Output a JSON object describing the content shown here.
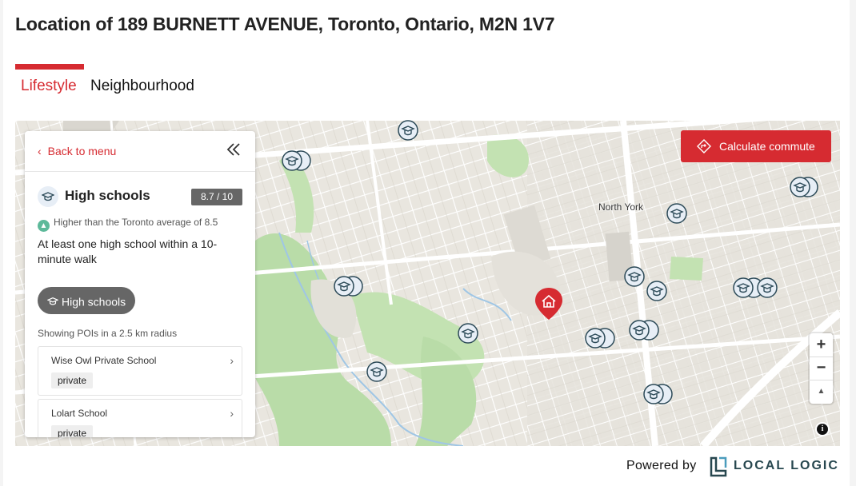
{
  "page": {
    "title": "Location of 189 BURNETT AVENUE, Toronto, Ontario, M2N 1V7"
  },
  "tabs": [
    {
      "label": "Lifestyle",
      "active": true
    },
    {
      "label": "Neighbourhood",
      "active": false
    }
  ],
  "panel": {
    "back_label": "Back to menu",
    "category_title": "High schools",
    "score": "8.7 / 10",
    "comparison": "Higher than the Toronto average of 8.5",
    "description": "At least one high school within a 10-minute walk",
    "filter_chip": "High schools",
    "radius_text": "Showing POIs in a 2.5 km radius",
    "pois": [
      {
        "name": "Wise Owl Private School",
        "tag": "private"
      },
      {
        "name": "Lolart School",
        "tag": "private"
      }
    ]
  },
  "map": {
    "commute_button": "Calculate commute",
    "place_label": "North York",
    "zoom_in": "+",
    "zoom_out": "−",
    "reset_north": "▲",
    "info": "i"
  },
  "footer": {
    "powered_by": "Powered by",
    "brand": "LOCAL LOGIC"
  },
  "colors": {
    "accent": "#d62b31",
    "score_bg": "#666666",
    "positive": "#5db99a",
    "brand": "#27474f"
  },
  "icons": {
    "back": "chevron-left-icon",
    "collapse": "double-chevron-left-icon",
    "school": "graduation-cap-icon",
    "commute": "directions-icon",
    "home": "house-icon",
    "info": "info-icon"
  }
}
